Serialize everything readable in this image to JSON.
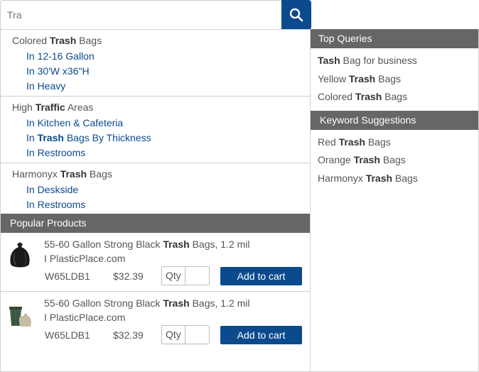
{
  "search": {
    "value": "Tra",
    "button_icon": "search-icon"
  },
  "suggestions": [
    {
      "head_pre": "Colored ",
      "head_bold": "Trash",
      "head_post": " Bags",
      "subs": [
        {
          "pre": "In 12-16 Gallon",
          "bold": "",
          "post": ""
        },
        {
          "pre": "In 30'W x36\"H",
          "bold": "",
          "post": ""
        },
        {
          "pre": "In Heavy",
          "bold": "",
          "post": ""
        }
      ]
    },
    {
      "head_pre": "High ",
      "head_bold": "Traffic",
      "head_post": " Areas",
      "subs": [
        {
          "pre": "In Kitchen & Cafeteria",
          "bold": "",
          "post": ""
        },
        {
          "pre": "In ",
          "bold": "Trash",
          "post": " Bags By Thickness"
        },
        {
          "pre": "In Restrooms",
          "bold": "",
          "post": ""
        }
      ]
    },
    {
      "head_pre": "Harmonyx ",
      "head_bold": "Trash",
      "head_post": " Bags",
      "subs": [
        {
          "pre": "In Deskside",
          "bold": "",
          "post": ""
        },
        {
          "pre": "In Restrooms",
          "bold": "",
          "post": ""
        }
      ]
    }
  ],
  "popular_products": {
    "header": "Popular Products",
    "qty_label": "Qty",
    "cart_label": "Add to cart",
    "items": [
      {
        "title_pre": "55-60 Gallon Strong Black ",
        "title_bold": "Trash",
        "title_post": " Bags, 1.2 mil",
        "title_line2": "I PlasticPlace.com",
        "sku": "W65LDB1",
        "price": "$32.39",
        "image": "black-trash-bag-icon"
      },
      {
        "title_pre": "55-60 Gallon Strong Black ",
        "title_bold": "Trash",
        "title_post": " Bags, 1.2 mil",
        "title_line2": "I PlasticPlace.com",
        "sku": "W65LDB1",
        "price": "$32.39",
        "image": "trash-can-with-bags-icon"
      }
    ]
  },
  "top_queries": {
    "header": "Top Queries",
    "items": [
      {
        "bold": "Tash",
        "post": " Bag for business",
        "pre": ""
      },
      {
        "pre": "Yellow ",
        "bold": "Trash",
        "post": " Bags"
      },
      {
        "pre": "Colored ",
        "bold": "Trash",
        "post": " Bags"
      }
    ]
  },
  "keyword_suggestions": {
    "header": "Keyword Suggestions",
    "items": [
      {
        "pre": "Red ",
        "bold": "Trash",
        "post": " Bags"
      },
      {
        "pre": "Orange ",
        "bold": "Trash",
        "post": " Bags"
      },
      {
        "pre": "Harmonyx ",
        "bold": "Trash",
        "post": " Bags"
      }
    ]
  },
  "colors": {
    "accent": "#0b4a8d",
    "header_bg": "#666666",
    "border": "#d0d0d0"
  }
}
